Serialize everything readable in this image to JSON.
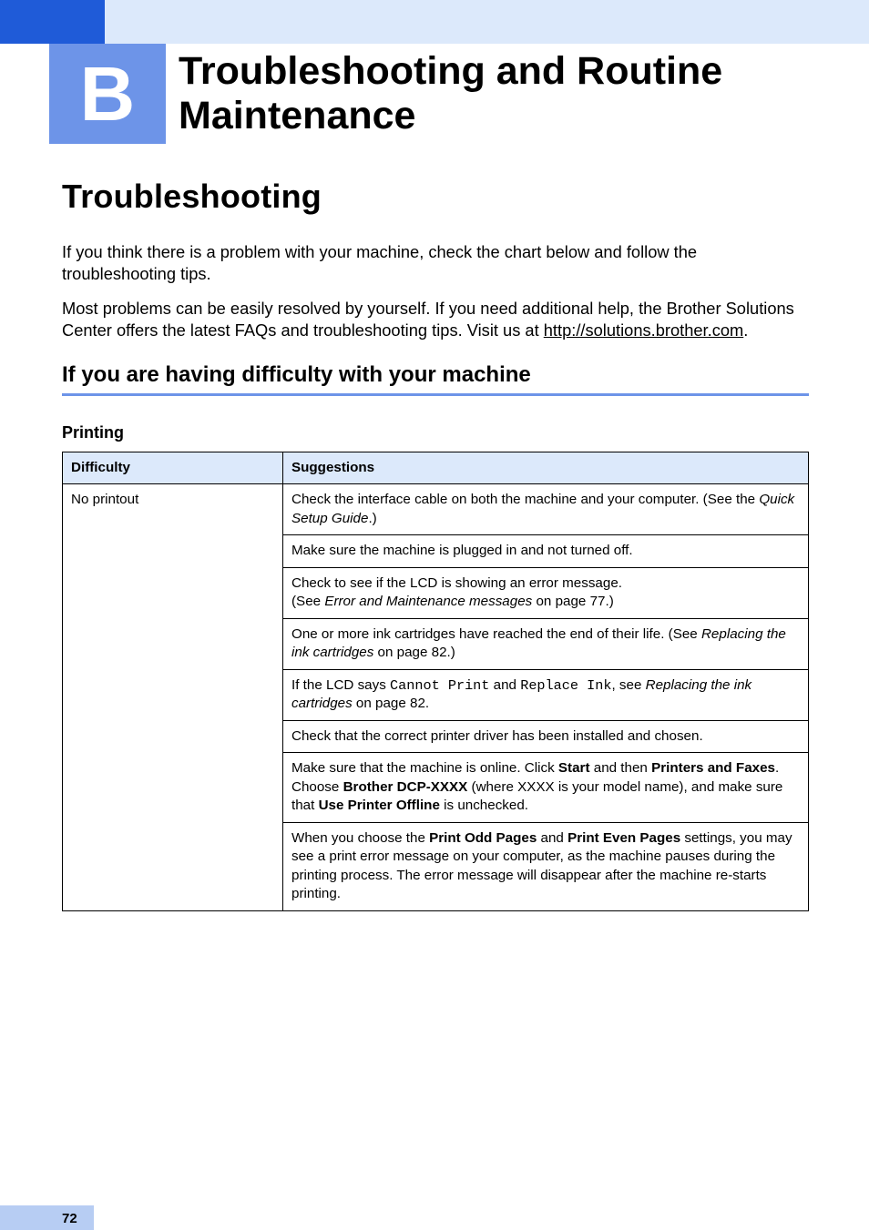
{
  "chapter": {
    "letter": "B",
    "title": "Troubleshooting and Routine Maintenance"
  },
  "section": {
    "heading": "Troubleshooting"
  },
  "intro": {
    "p1": "If you think there is a problem with your machine, check the chart below and follow the troubleshooting tips.",
    "p2": "Most problems can be easily resolved by yourself. If you need additional help, the Brother Solutions Center offers the latest FAQs and troubleshooting tips. Visit us at ",
    "link": "http://solutions.brother.com",
    "p2_after": "."
  },
  "subsection": {
    "heading": "If you are having difficulty with your machine"
  },
  "table": {
    "caption": "Printing",
    "headers": {
      "difficulty": "Difficulty",
      "suggestions": "Suggestions"
    },
    "rows": [
      {
        "difficulty": "No printout",
        "suggestions": [
          {
            "pre": "Check the interface cable on both the machine and your computer. (See the ",
            "ital1": "Quick Setup Guide",
            "post": ".)"
          },
          {
            "text": "Make sure the machine is plugged in and not turned off."
          },
          {
            "line1": "Check to see if the LCD is showing an error message.",
            "line2_pre": "(See ",
            "line2_ital": "Error and Maintenance messages",
            "line2_post": " on page 77.)"
          },
          {
            "pre": "One or more ink cartridges have reached the end of their life. (See ",
            "ital1": "Replacing the ink cartridges",
            "post": " on page 82.)"
          },
          {
            "pre": "If the LCD says ",
            "mono1": "Cannot Print",
            "mid1": " and ",
            "mono2": "Replace Ink",
            "mid2": ", see ",
            "ital1": "Replacing the ink cartridges",
            "post": " on page 82."
          },
          {
            "text": "Check that the correct printer driver has been installed and chosen."
          },
          {
            "pre": "Make sure that the machine is online. Click ",
            "b1": "Start",
            "m1": " and then ",
            "b2": "Printers and Faxes",
            "m2": ". Choose ",
            "b3": "Brother DCP-XXXX",
            "m3": " (where XXXX is your model name), and make sure that ",
            "b4": "Use Printer Offline",
            "post": " is unchecked."
          },
          {
            "pre": "When you choose the ",
            "b1": "Print Odd Pages",
            "m1": " and ",
            "b2": "Print Even Pages",
            "post": " settings, you may see a print error message on your computer, as the machine pauses during the printing process. The error message will disappear after the machine re-starts printing."
          }
        ]
      }
    ]
  },
  "page_number": "72"
}
